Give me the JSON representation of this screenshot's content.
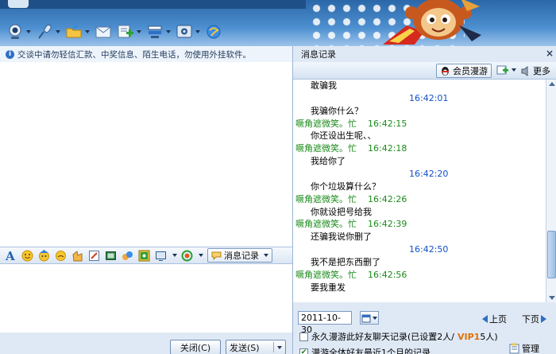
{
  "notice": {
    "text": "交谈中请勿轻信汇款、中奖信息、陌生电话，勿使用外挂软件。"
  },
  "toolbar": {
    "icons": [
      "webcam-icon",
      "microphone-icon",
      "folder-send-icon",
      "image-icon",
      "apps-icon",
      "group-icon",
      "settings-icon",
      "qzone-icon"
    ]
  },
  "format_bar": {
    "icons": [
      "font-icon",
      "emoticon-icon",
      "magic-face-icon",
      "shake-icon",
      "gift-icon",
      "doodle-icon",
      "screenshot-icon",
      "lucky-icon",
      "music-icon",
      "cast-icon",
      "theme-icon"
    ],
    "history_label": "消息记录"
  },
  "buttons": {
    "close_label": "关闭(C)",
    "send_label": "发送(S)"
  },
  "history_panel": {
    "title": "消息记录",
    "close_glyph": "×",
    "vip_roam_label": "会员漫游",
    "more_label": "更多",
    "contact_name": "噘角遮微笑。忙",
    "rows": [
      {
        "kind": "msg",
        "text": "敢骗我"
      },
      {
        "kind": "time",
        "time": "16:42:01"
      },
      {
        "kind": "msg",
        "text": "我骗你什么？"
      },
      {
        "kind": "name",
        "time": "16:42:15"
      },
      {
        "kind": "msg",
        "text": "你还设出生呢、、"
      },
      {
        "kind": "name",
        "time": "16:42:18"
      },
      {
        "kind": "msg",
        "text": "我给你了"
      },
      {
        "kind": "time",
        "time": "16:42:20"
      },
      {
        "kind": "msg",
        "text": "你个垃圾算什么？"
      },
      {
        "kind": "name",
        "time": "16:42:26"
      },
      {
        "kind": "msg",
        "text": "你就设把号给我"
      },
      {
        "kind": "name",
        "time": "16:42:39"
      },
      {
        "kind": "msg",
        "text": "还骗我说你删了"
      },
      {
        "kind": "time",
        "time": "16:42:50"
      },
      {
        "kind": "msg",
        "text": "我不是把东西删了"
      },
      {
        "kind": "name",
        "time": "16:42:56"
      },
      {
        "kind": "msg",
        "text": "要我重发"
      }
    ],
    "date": "2011-10-30",
    "prev_label": "上页",
    "next_label": "下页",
    "option1": {
      "text_a": "永久漫游此好友聊天记录(已设置2人/",
      "vip": "VIP1",
      "text_b": "5人)",
      "checked": false
    },
    "option2": {
      "text": "漫游全体好友最近1个月的记录",
      "checked": true
    },
    "manage_label": "管理"
  },
  "colors": {
    "name": "#1a8a1a",
    "time": "#1150c8",
    "header_top": "#2a67a8",
    "panel_bg": "#dfe9f5"
  }
}
